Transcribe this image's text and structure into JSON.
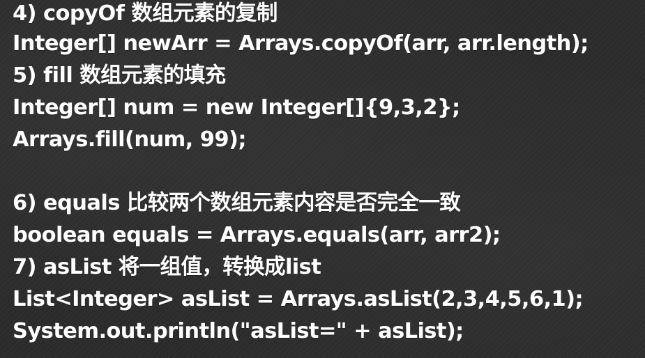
{
  "lines": [
    "4) copyOf 数组元素的复制",
    "Integer[] newArr = Arrays.copyOf(arr, arr.length);",
    "5) fill 数组元素的填充",
    "Integer[] num = new Integer[]{9,3,2};",
    "Arrays.fill(num, 99);",
    "",
    "6) equals 比较两个数组元素内容是否完全一致",
    "boolean equals = Arrays.equals(arr, arr2);",
    "7) asList 将一组值，转换成list",
    "List<Integer> asList = Arrays.asList(2,3,4,5,6,1);",
    "System.out.println(\"asList=\" + asList);"
  ],
  "colors": {
    "background": "#2b2b2b",
    "text": "#ffffff"
  }
}
